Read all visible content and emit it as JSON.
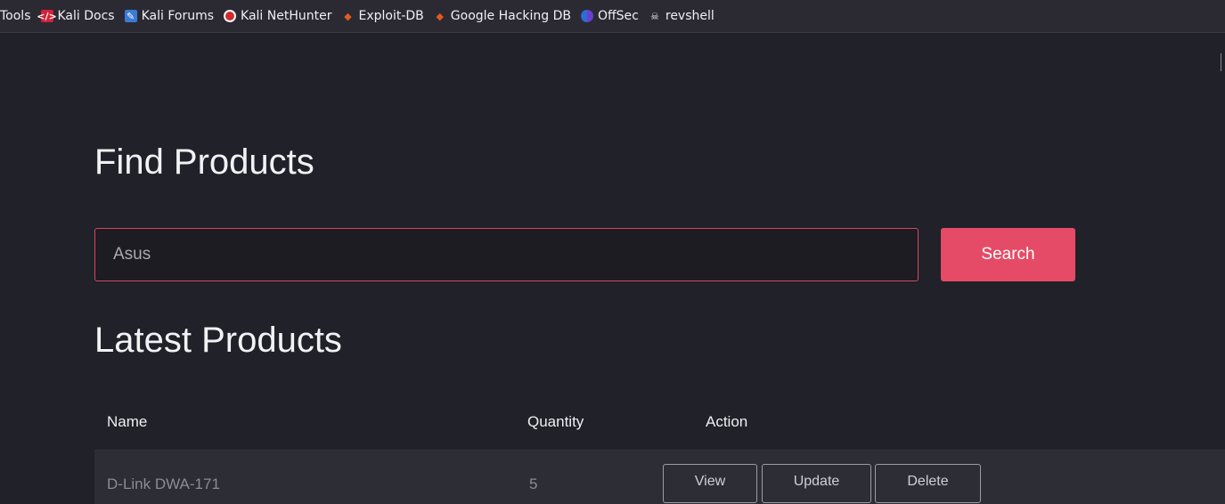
{
  "bookmarks": [
    {
      "label": "Tools",
      "icon": "none"
    },
    {
      "label": "Kali Docs",
      "icon": "kali-docs-icon"
    },
    {
      "label": "Kali Forums",
      "icon": "kali-forums-icon"
    },
    {
      "label": "Kali NetHunter",
      "icon": "nethunter-icon"
    },
    {
      "label": "Exploit-DB",
      "icon": "exploit-db-icon"
    },
    {
      "label": "Google Hacking DB",
      "icon": "ghdb-icon"
    },
    {
      "label": "OffSec",
      "icon": "offsec-icon"
    },
    {
      "label": "revshell",
      "icon": "skull-icon"
    }
  ],
  "find": {
    "title": "Find Products",
    "search_value": "Asus",
    "search_button": "Search"
  },
  "latest": {
    "title": "Latest Products",
    "columns": [
      "Name",
      "Quantity",
      "Action"
    ],
    "rows": [
      {
        "name": "D-Link DWA-171",
        "quantity": "5",
        "actions": [
          "View",
          "Update",
          "Delete"
        ]
      }
    ]
  },
  "colors": {
    "accent": "#e54b66",
    "background": "#202129",
    "bookmarks_bar": "#2b2a33"
  }
}
